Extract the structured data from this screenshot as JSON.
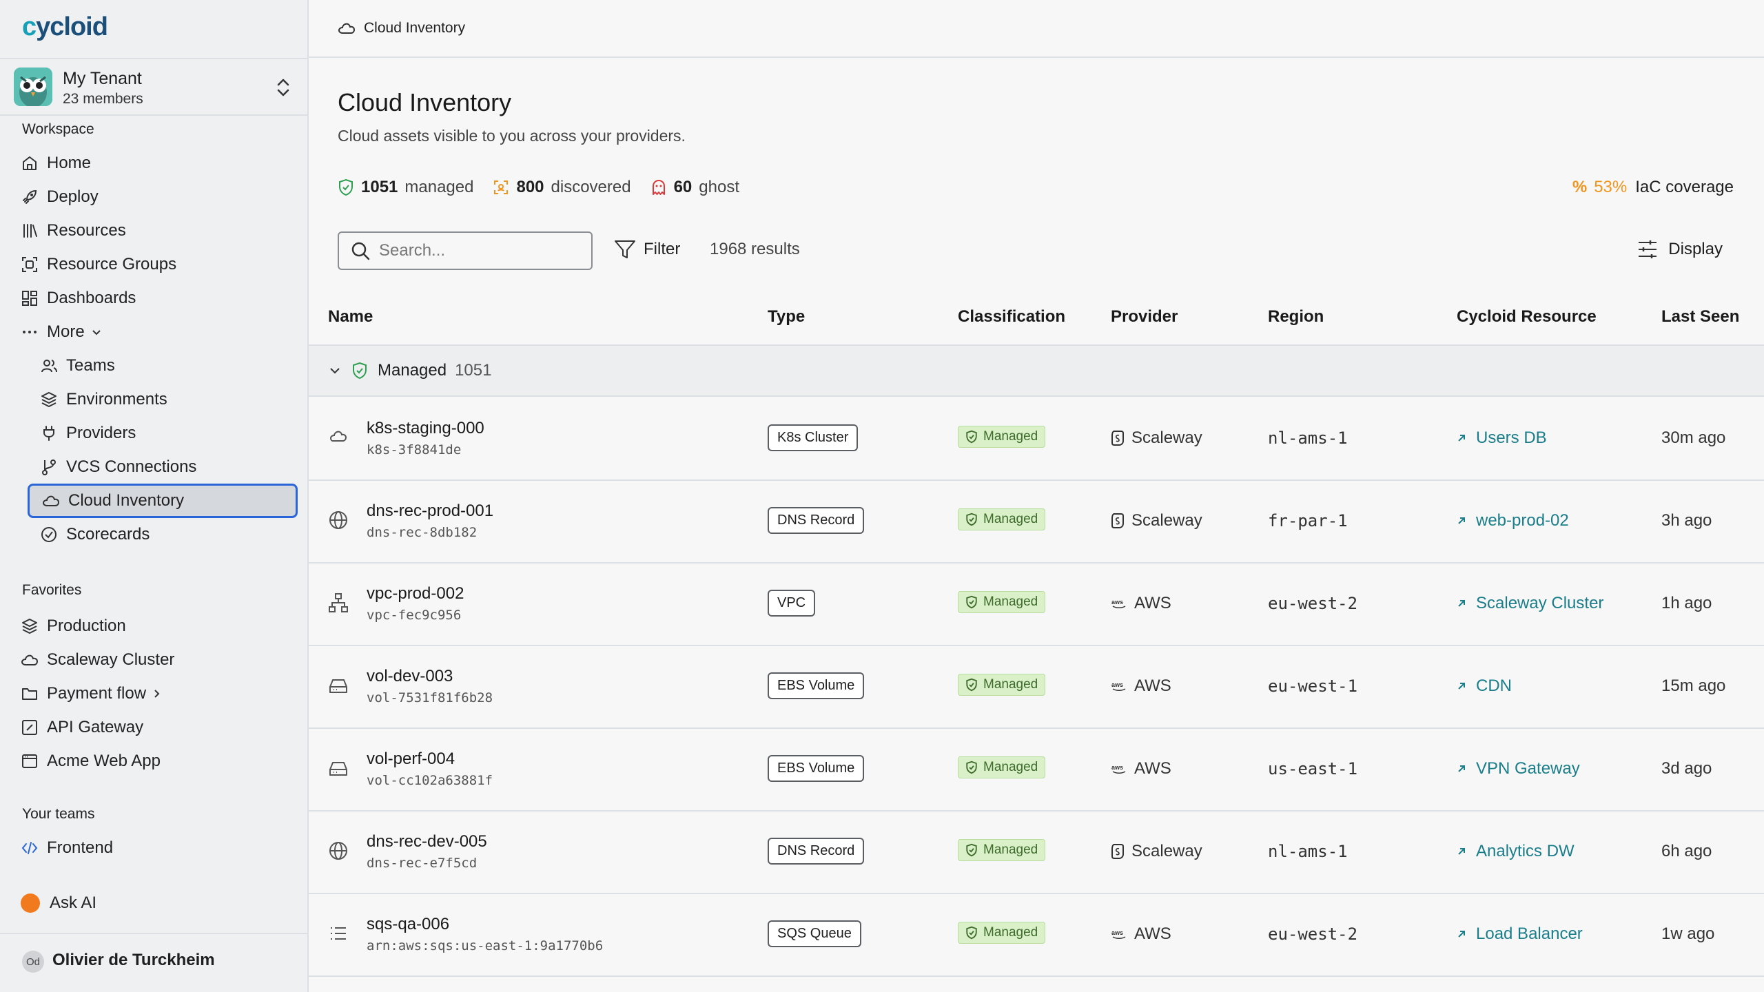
{
  "brand": {
    "logo_a": "c",
    "logo_b": "ycloid"
  },
  "tenant": {
    "name": "My Tenant",
    "members": "23 members"
  },
  "sidebar": {
    "workspace_title": "Workspace",
    "workspace": [
      {
        "label": "Home",
        "icon": "home-icon"
      },
      {
        "label": "Deploy",
        "icon": "rocket-icon"
      },
      {
        "label": "Resources",
        "icon": "library-icon"
      },
      {
        "label": "Resource Groups",
        "icon": "group-icon"
      },
      {
        "label": "Dashboards",
        "icon": "dashboard-icon"
      },
      {
        "label": "More",
        "icon": "ellipsis-icon"
      }
    ],
    "more_items": [
      {
        "label": "Teams",
        "icon": "users-icon"
      },
      {
        "label": "Environments",
        "icon": "layers-icon"
      },
      {
        "label": "Providers",
        "icon": "plug-icon"
      },
      {
        "label": "VCS Connections",
        "icon": "git-branch-icon"
      },
      {
        "label": "Cloud Inventory",
        "icon": "cloud-icon",
        "active": true
      },
      {
        "label": "Scorecards",
        "icon": "check-circle-icon"
      }
    ],
    "favorites_title": "Favorites",
    "favorites": [
      {
        "label": "Production",
        "icon": "layers-icon"
      },
      {
        "label": "Scaleway Cluster",
        "icon": "cloud-icon"
      },
      {
        "label": "Payment flow",
        "icon": "folder-icon"
      },
      {
        "label": "API Gateway",
        "icon": "square-pen-icon"
      },
      {
        "label": "Acme Web App",
        "icon": "browser-icon"
      }
    ],
    "teams_title": "Your teams",
    "teams": [
      {
        "label": "Frontend",
        "icon": "code-icon"
      }
    ],
    "ask_ai": "Ask AI",
    "user": {
      "initials": "Od",
      "name": "Olivier de Turckheim"
    }
  },
  "header": {
    "breadcrumb": "Cloud Inventory"
  },
  "page": {
    "title": "Cloud Inventory",
    "subtitle": "Cloud assets visible to you across your providers.",
    "stats": [
      {
        "count": "1051",
        "label": "managed",
        "icon": "shield-check-icon",
        "color": "#2e9e4f"
      },
      {
        "count": "800",
        "label": "discovered",
        "icon": "scan-icon",
        "color": "#f0951d"
      },
      {
        "count": "60",
        "label": "ghost",
        "icon": "ghost-icon",
        "color": "#d93b3b"
      }
    ],
    "iac": {
      "symbol": "%",
      "value": "53%",
      "label": "IaC coverage"
    },
    "search_placeholder": "Search...",
    "filter_label": "Filter",
    "results": "1968 results",
    "display_label": "Display"
  },
  "table": {
    "columns": [
      "Name",
      "Type",
      "Classification",
      "Provider",
      "Region",
      "Cycloid Resource",
      "Last Seen"
    ],
    "group": {
      "label": "Managed",
      "count": "1051"
    },
    "rows": [
      {
        "icon": "cloud-icon",
        "name": "k8s-staging-000",
        "id": "k8s-3f8841de",
        "type": "K8s Cluster",
        "classification": "Managed",
        "provider": "Scaleway",
        "region": "nl-ams-1",
        "resource": "Users DB",
        "last_seen": "30m ago"
      },
      {
        "icon": "globe-icon",
        "name": "dns-rec-prod-001",
        "id": "dns-rec-8db182",
        "type": "DNS Record",
        "classification": "Managed",
        "provider": "Scaleway",
        "region": "fr-par-1",
        "resource": "web-prod-02",
        "last_seen": "3h ago"
      },
      {
        "icon": "network-icon",
        "name": "vpc-prod-002",
        "id": "vpc-fec9c956",
        "type": "VPC",
        "classification": "Managed",
        "provider": "AWS",
        "region": "eu-west-2",
        "resource": "Scaleway Cluster",
        "last_seen": "1h ago"
      },
      {
        "icon": "drive-icon",
        "name": "vol-dev-003",
        "id": "vol-7531f81f6b28",
        "type": "EBS Volume",
        "classification": "Managed",
        "provider": "AWS",
        "region": "eu-west-1",
        "resource": "CDN",
        "last_seen": "15m ago"
      },
      {
        "icon": "drive-icon",
        "name": "vol-perf-004",
        "id": "vol-cc102a63881f",
        "type": "EBS Volume",
        "classification": "Managed",
        "provider": "AWS",
        "region": "us-east-1",
        "resource": "VPN Gateway",
        "last_seen": "3d ago"
      },
      {
        "icon": "globe-icon",
        "name": "dns-rec-dev-005",
        "id": "dns-rec-e7f5cd",
        "type": "DNS Record",
        "classification": "Managed",
        "provider": "Scaleway",
        "region": "nl-ams-1",
        "resource": "Analytics DW",
        "last_seen": "6h ago"
      },
      {
        "icon": "list-icon",
        "name": "sqs-qa-006",
        "id": "arn:aws:sqs:us-east-1:9a1770b6",
        "type": "SQS Queue",
        "classification": "Managed",
        "provider": "AWS",
        "region": "eu-west-2",
        "resource": "Load Balancer",
        "last_seen": "1w ago"
      }
    ]
  }
}
